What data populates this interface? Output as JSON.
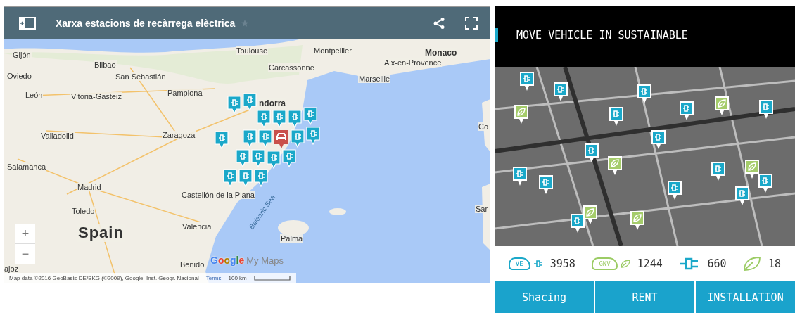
{
  "map_panel": {
    "title": "Xarxa estacions de recàrrega elèctrica",
    "map_labels": [
      {
        "text": "Gijón",
        "kind": "city"
      },
      {
        "text": "Bilbao",
        "kind": "city"
      },
      {
        "text": "Oviedo",
        "kind": "city"
      },
      {
        "text": "San Sebastián",
        "kind": "city"
      },
      {
        "text": "León",
        "kind": "city"
      },
      {
        "text": "Vitoria-Gasteiz",
        "kind": "city"
      },
      {
        "text": "Pamplona",
        "kind": "city"
      },
      {
        "text": "Toulouse",
        "kind": "city"
      },
      {
        "text": "Montpellier",
        "kind": "city"
      },
      {
        "text": "Carcassonne",
        "kind": "city"
      },
      {
        "text": "Monaco",
        "kind": "country"
      },
      {
        "text": "Aix-en-Provence",
        "kind": "city"
      },
      {
        "text": "Marseille",
        "kind": "city"
      },
      {
        "text": "ndorra",
        "kind": "country"
      },
      {
        "text": "Valladolid",
        "kind": "city"
      },
      {
        "text": "Zaragoza",
        "kind": "city"
      },
      {
        "text": "Salamanca",
        "kind": "city"
      },
      {
        "text": "Madrid",
        "kind": "city"
      },
      {
        "text": "Toledo",
        "kind": "city"
      },
      {
        "text": "Spain",
        "kind": "country"
      },
      {
        "text": "Castellón de la Plana",
        "kind": "city"
      },
      {
        "text": "Valencia",
        "kind": "city"
      },
      {
        "text": "Balearic Sea",
        "kind": "sea"
      },
      {
        "text": "Palma",
        "kind": "city"
      },
      {
        "text": "Benido",
        "kind": "city"
      },
      {
        "text": "Co",
        "kind": "city"
      },
      {
        "text": "Sar",
        "kind": "city"
      },
      {
        "text": "ajoz",
        "kind": "city"
      }
    ],
    "zoom_in": "+",
    "zoom_out": "−",
    "logo": {
      "brand": "Google",
      "product": "My Maps"
    },
    "attribution": "Map data ©2016 GeoBasis-DE/BKG (©2009), Google, Inst. Geogr. Nacional",
    "terms": "Terms",
    "scale": "100 km"
  },
  "promo_panel": {
    "heading": "MOVE VEHICLE IN SUSTAINABLE",
    "stats": [
      {
        "kind": "ev-car",
        "badge": "VE",
        "count": "3958",
        "color": "#1ba8c9"
      },
      {
        "kind": "gnv-car",
        "badge": "GNV",
        "count": "1244",
        "color": "#9ccc65"
      },
      {
        "kind": "charger",
        "count": "660",
        "color": "#1ba8c9"
      },
      {
        "kind": "leaf",
        "count": "18",
        "color": "#9ccc65"
      }
    ],
    "buttons": [
      "Shacing",
      "RENT",
      "INSTALLATION"
    ]
  }
}
